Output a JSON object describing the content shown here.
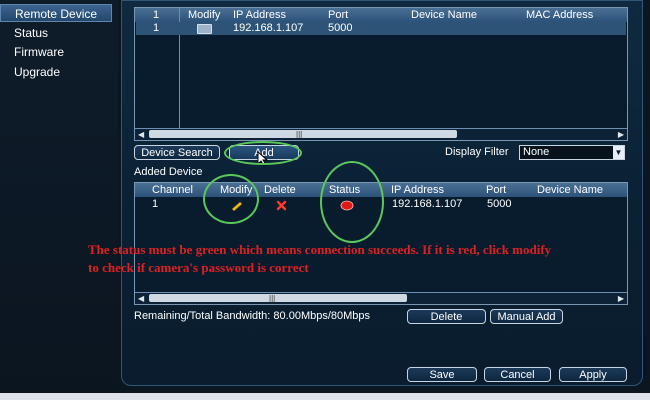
{
  "sidebar": {
    "items": [
      {
        "label": "Remote Device",
        "selected": true
      },
      {
        "label": "Status",
        "selected": false
      },
      {
        "label": "Firmware",
        "selected": false
      },
      {
        "label": "Upgrade",
        "selected": false
      }
    ]
  },
  "search_table": {
    "headers": [
      "1",
      "Modify",
      "IP Address",
      "Port",
      "Device Name",
      "MAC Address"
    ],
    "rows": [
      {
        "index": "1",
        "modify_icon": "edit-icon",
        "ip": "192.168.1.107",
        "port": "5000",
        "device_name": "",
        "mac": ""
      }
    ]
  },
  "controls": {
    "device_search": "Device Search",
    "add": "Add",
    "display_filter_label": "Display Filter",
    "display_filter_value": "None"
  },
  "added_device": {
    "title": "Added Device",
    "headers": [
      "Channel",
      "Modify",
      "Delete",
      "Status",
      "IP Address",
      "Port",
      "Device Name"
    ],
    "rows": [
      {
        "channel": "1",
        "modify_icon": "pencil-icon",
        "delete_icon": "red-x-icon",
        "status_icon": "red-status-dot",
        "ip": "192.168.1.107",
        "port": "5000",
        "device_name": ""
      }
    ]
  },
  "annotation": "The status must be green which means connection succeeds. If it is red, click modify to check if camera's password is correct",
  "bandwidth": "Remaining/Total Bandwidth: 80.00Mbps/80Mbps",
  "buttons": {
    "delete": "Delete",
    "manual_add": "Manual Add",
    "save": "Save",
    "cancel": "Cancel",
    "apply": "Apply"
  },
  "colors": {
    "status_red": "#e01818",
    "highlight_ring": "#5ac85a",
    "annotation_text": "#e02020"
  }
}
